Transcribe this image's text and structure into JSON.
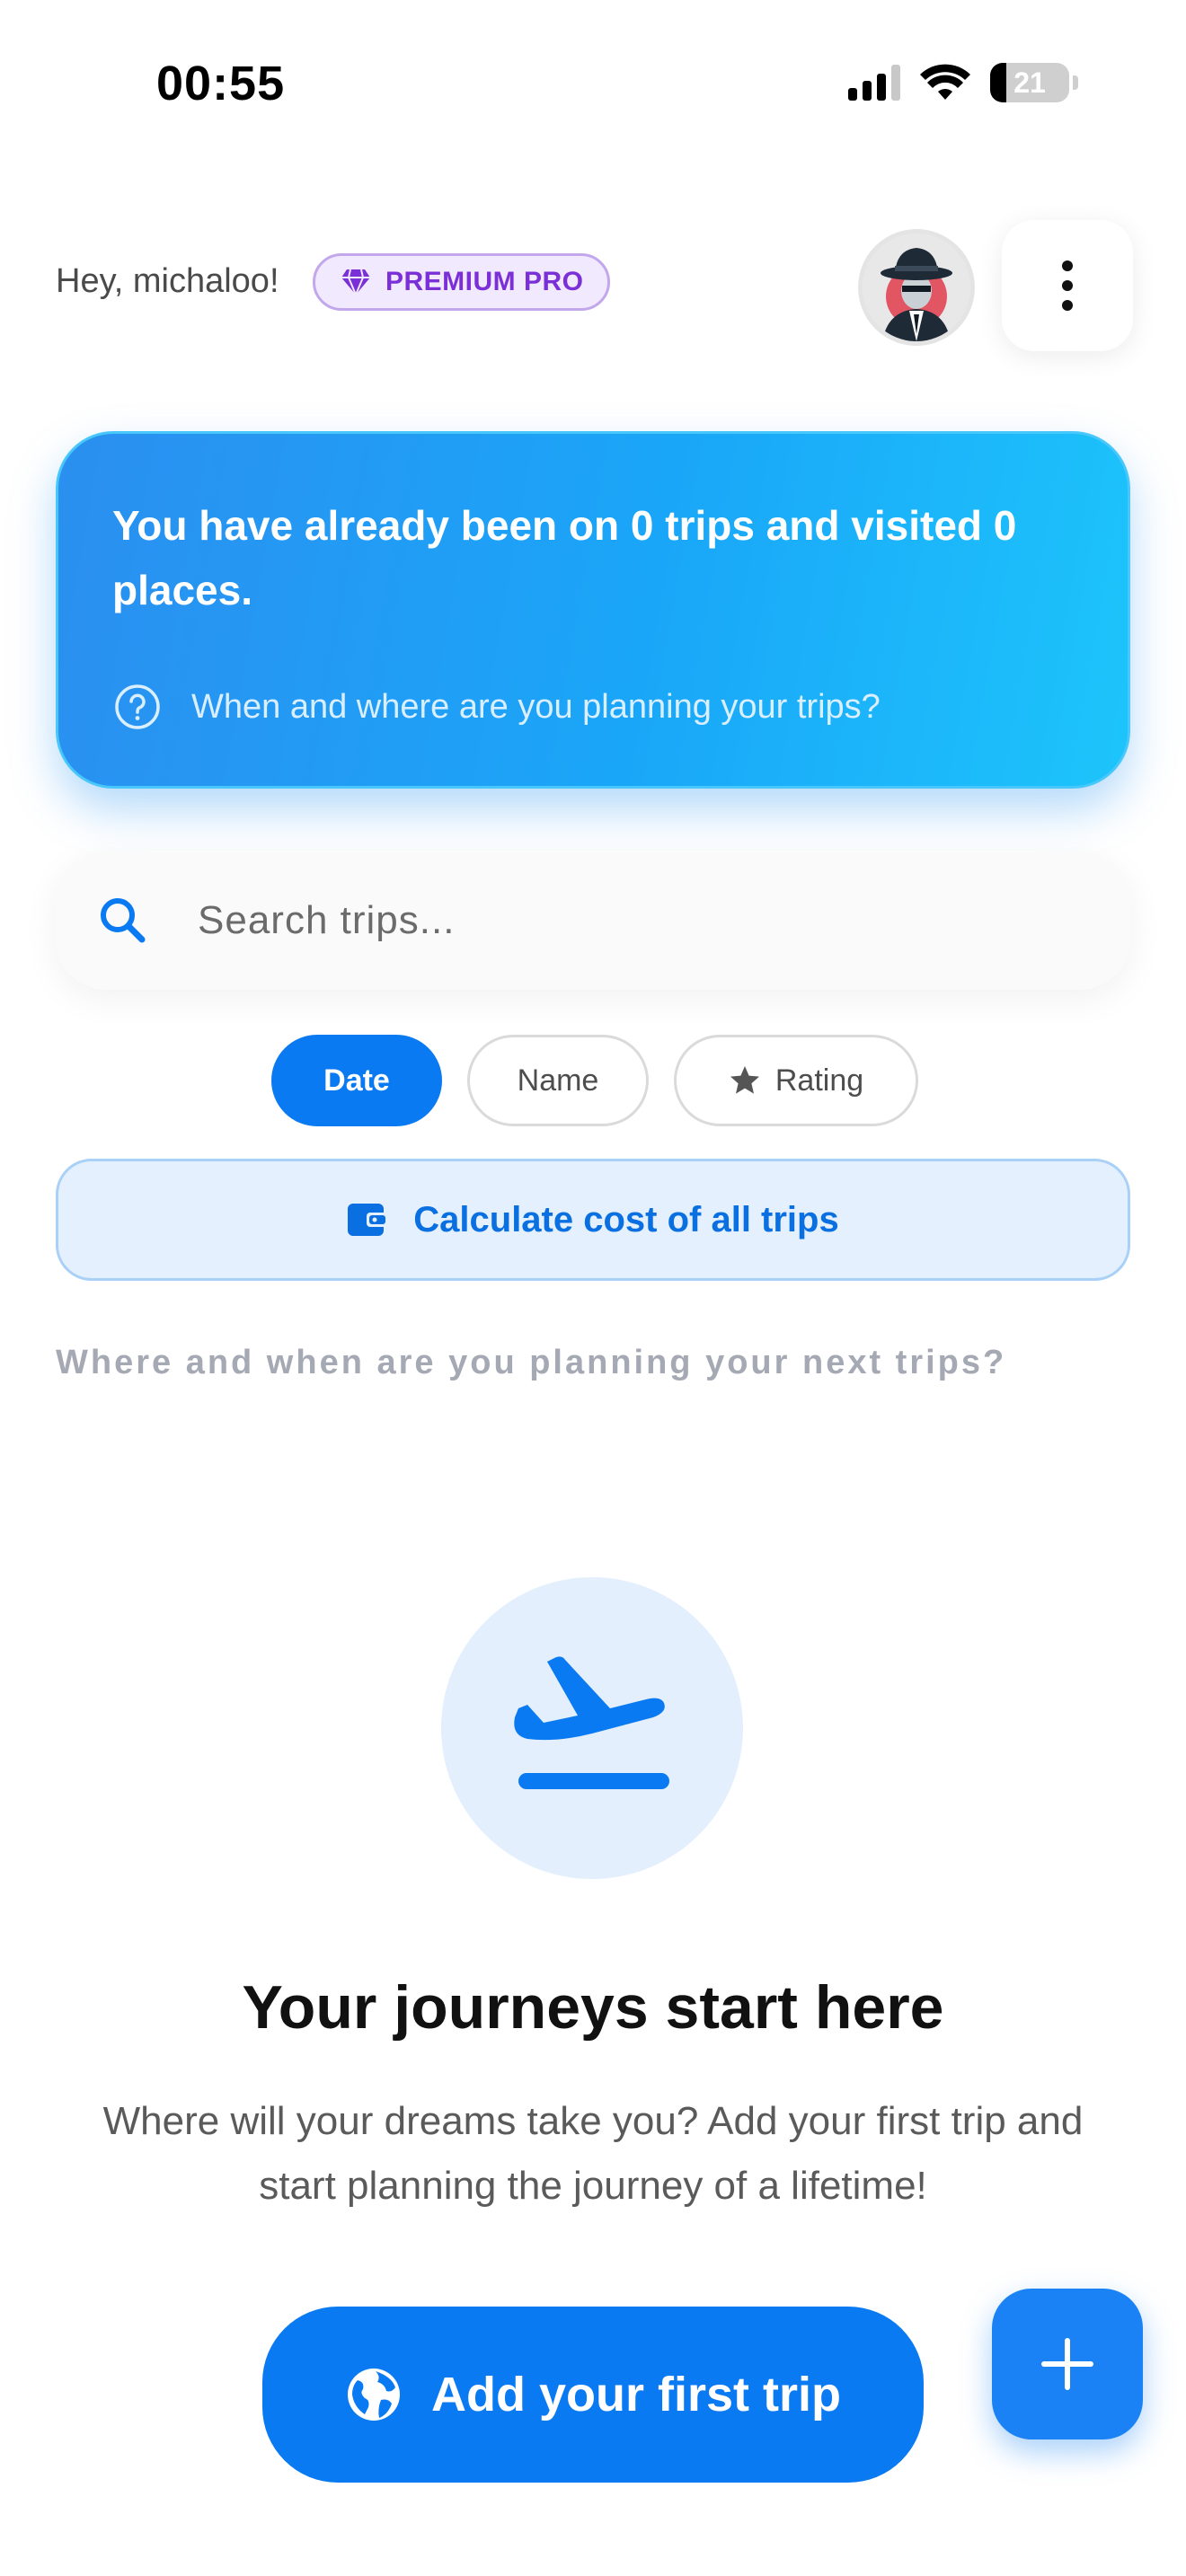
{
  "status_bar": {
    "time": "00:55",
    "battery_level": "21",
    "icons": [
      "signal-icon",
      "wifi-icon",
      "battery-icon"
    ]
  },
  "header": {
    "greeting": "Hey, michaloo!",
    "badge_label": "PREMIUM PRO",
    "badge_icon": "gem-icon",
    "avatar": "avatar-detective",
    "menu_icon": "more-vertical-icon"
  },
  "stats_card": {
    "title": "You have already been on 0 trips and visited 0 places.",
    "hint": "When and where are you planning your trips?",
    "hint_icon": "help-circle-icon"
  },
  "search": {
    "placeholder": "Search trips...",
    "value": ""
  },
  "sort_chips": {
    "date": "Date",
    "name": "Name",
    "rating": "Rating",
    "active": "Date"
  },
  "cost_button": {
    "label": "Calculate cost of all trips",
    "icon": "wallet-icon"
  },
  "section_caption": "Where and when are you planning your next trips?",
  "empty_state": {
    "icon": "plane-takeoff-icon",
    "title": "Your journeys start here",
    "description": "Where will your dreams take you? Add your first trip and start planning the journey of a lifetime!"
  },
  "add_first_button": {
    "label": "Add your first trip",
    "icon": "globe-icon"
  },
  "fab": {
    "icon": "plus-icon"
  },
  "colors": {
    "accent": "#0a7af2",
    "premium": "#7b2fd6",
    "card_gradient_start": "#2b8ff0",
    "card_gradient_end": "#1dc4fb",
    "caption_gray": "#a5a9b4"
  }
}
